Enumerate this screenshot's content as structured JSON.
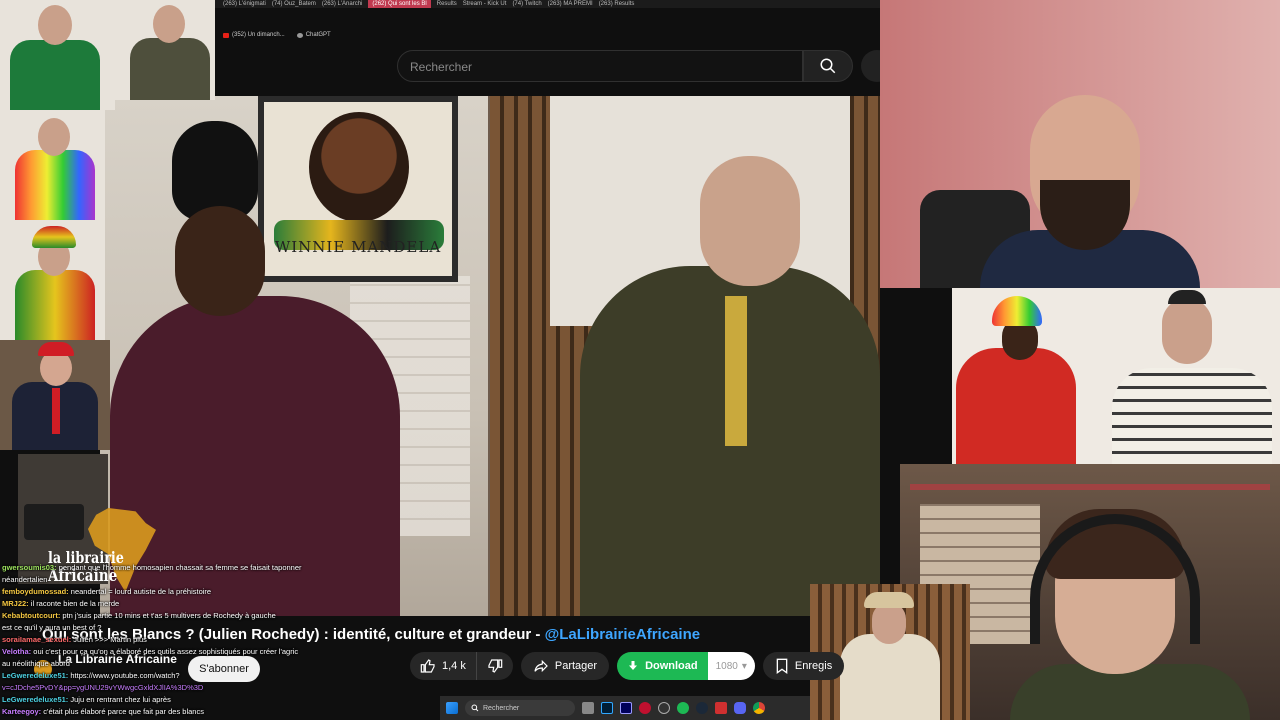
{
  "browser": {
    "tabs": [
      {
        "label": "(263) L'énigmati",
        "active": false
      },
      {
        "label": "(74) Ouz_Batem",
        "active": false
      },
      {
        "label": "(263) L'Anarchi",
        "active": false
      },
      {
        "label": "(262) Qui sont les Bl",
        "active": true
      },
      {
        "label": "Results",
        "active": false
      },
      {
        "label": "Stream - Kick Ut",
        "active": false
      },
      {
        "label": "(74) Twitch",
        "active": false
      },
      {
        "label": "(263) MA PREMI",
        "active": false
      },
      {
        "label": "(263) Results",
        "active": false
      }
    ],
    "bookmarks": [
      {
        "label": "(352) Un dimanch...",
        "icon": "youtube-icon"
      },
      {
        "label": "ChatGPT",
        "icon": "chatgpt-icon"
      }
    ]
  },
  "header": {
    "search_placeholder": "Rechercher"
  },
  "video": {
    "poster_text": "WINNIE MANDELA",
    "title_main": "Qui sont les Blancs ? (Julien Rochedy) : identité, culture et grandeur - ",
    "title_link": "@LaLibrairieAfricaine",
    "channel_name": "La Librairie Africaine",
    "subscribe_label": "S'abonner",
    "like_count": "1,4 k",
    "share_label": "Partager",
    "download_label": "Download",
    "quality": "1080",
    "save_label": "Enregis"
  },
  "logo": {
    "line1": "la librairie",
    "line2": "Africaine"
  },
  "chat": [
    {
      "user": "gwersoumis03:",
      "text": " pendant que l'homme homosapien chassait sa femme se faisait taponner",
      "color": "#9be15d"
    },
    {
      "user": "",
      "text": "néandertalien",
      "color": "#ffffff"
    },
    {
      "user": "femboydumossad:",
      "text": " neandertal = lourd autiste de la préhistoire",
      "color": "#f5c842"
    },
    {
      "user": "MRJ22:",
      "text": " il raconte bien de la merde",
      "color": "#f5c842"
    },
    {
      "user": "Kebabtoutcourt:",
      "text": " ptn j'suis partie 10 mins et t'as 5 multivers de Rochedy à gauche",
      "color": "#f5c842"
    },
    {
      "user": "",
      "text": "est ce qu'il y aura un best of ?",
      "color": "#ffffff"
    },
    {
      "user": "soraiIamae_sexuel:",
      "text": " Julien >>> Martin plus",
      "color": "#ff6b6b"
    },
    {
      "user": "Velotha:",
      "text": " oui c'est pour ça qu'on a élaboré des outils assez sophistiqués pour créer l'agric",
      "color": "#c77dff"
    },
    {
      "user": "",
      "text": "au néolithique abord",
      "color": "#ffffff"
    },
    {
      "user": "LeGweredeluxe51:",
      "text": " https://www.youtube.com/watch?",
      "color": "#4dd0e1"
    },
    {
      "user": "",
      "text": "v=cJDche5PvDY&pp=ygUNU29vYWwgcGxldXJlIA%3D%3D",
      "color": "#c77dff"
    },
    {
      "user": "LeGweredeluxe51:",
      "text": " Juju en rentrant chez lui après",
      "color": "#4dd0e1"
    },
    {
      "user": "Karteegoy:",
      "text": " c'était plus élaboré parce que fait par des blancs",
      "color": "#c77dff"
    }
  ],
  "taskbar": {
    "search_label": "Rechercher",
    "icons": [
      "windows-icon",
      "file-explorer-icon",
      "photoshop-icon",
      "premiere-icon",
      "opera-icon",
      "obs-icon",
      "spotify-icon",
      "steam-icon",
      "recorder-icon",
      "discord-icon",
      "chrome-icon"
    ]
  },
  "colors": {
    "youtube_red": "#ff0000",
    "link_blue": "#3ea6ff",
    "download_green": "#1db954",
    "background": "#0f0f0f"
  }
}
